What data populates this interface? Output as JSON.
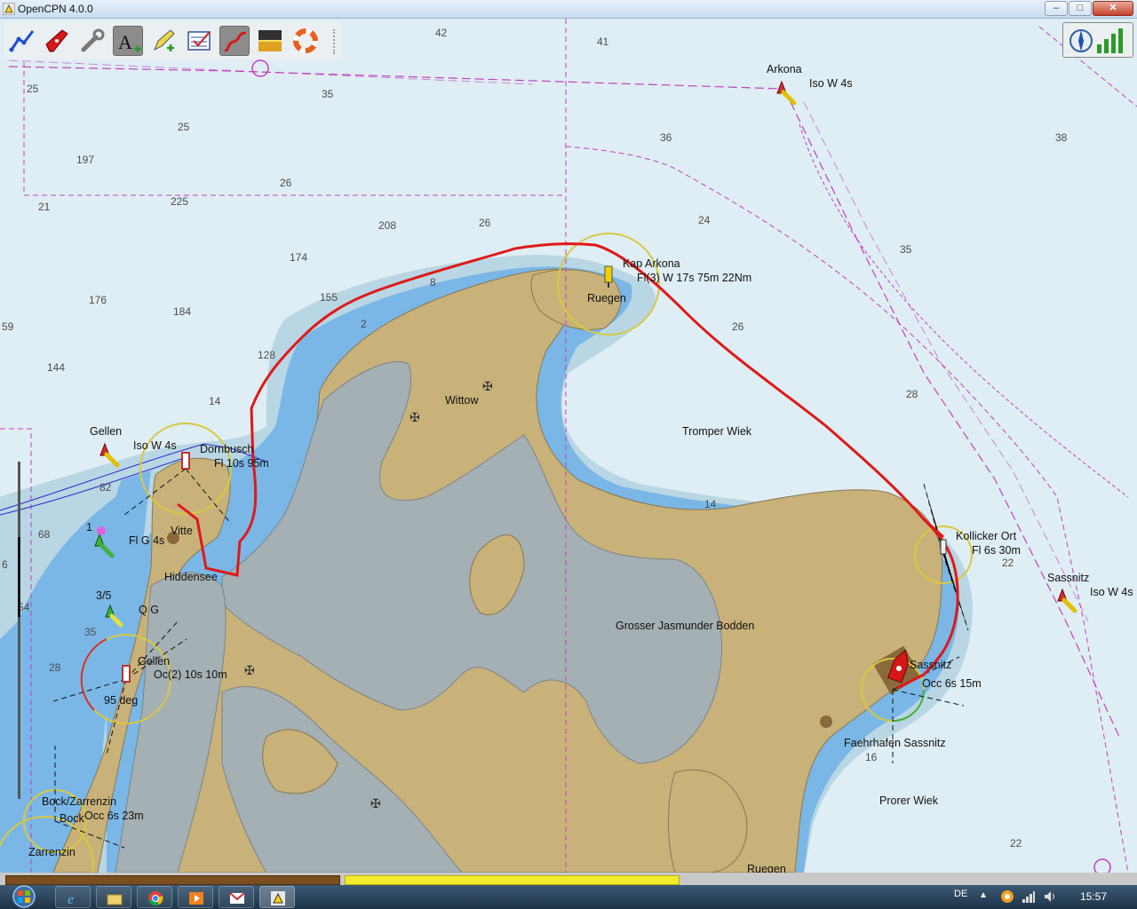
{
  "window": {
    "title": "OpenCPN 4.0.0",
    "minimize_icon": "minimize-icon",
    "maximize_icon": "maximize-icon",
    "close_icon": "close-icon",
    "minimize_glyph": "–",
    "maximize_glyph": "□",
    "close_glyph": "✕"
  },
  "toolbar": {
    "tools": [
      {
        "name": "route-tool",
        "icon": "route-icon"
      },
      {
        "name": "ownship-tool",
        "icon": "ship-icon"
      },
      {
        "name": "settings-tool",
        "icon": "wrench-icon"
      },
      {
        "name": "text-tool",
        "icon": "text-add-icon",
        "active": true
      },
      {
        "name": "mark-tool",
        "icon": "pencil-icon"
      },
      {
        "name": "chart-info-tool",
        "icon": "chart-check-icon"
      },
      {
        "name": "track-tool",
        "icon": "track-icon",
        "active": true
      },
      {
        "name": "color-scheme-tool",
        "icon": "dusk-icon"
      },
      {
        "name": "mob-tool",
        "icon": "lifebuoy-icon"
      }
    ]
  },
  "status_icons": {
    "compass": "compass-icon",
    "gps": "gps-signal-icon"
  },
  "chart": {
    "place_names": {
      "arkona": "Arkona",
      "kap_arkona": "Kap Arkona",
      "ruegen": "Ruegen",
      "wittow": "Wittow",
      "tromper_wiek": "Tromper Wiek",
      "grosser_jasmunder_bodden": "Grosser Jasmunder Bodden",
      "kollicker_ort": "Kollicker Ort",
      "sassnitz_east": "Sassnitz",
      "sassnitz_port": "Sassnitz",
      "faehrhafen": "Faehrhafen Sassnitz",
      "prorer_wiek": "Prorer Wiek",
      "gellen": "Gellen",
      "dornbusch": "Dornbusch",
      "vitte": "Vitte",
      "hiddensee": "Hiddensee",
      "bock_zarrenzin": "Bock/Zarrenzin",
      "bock": "Bock",
      "zarrenzin": "Zarrenzin",
      "gellen_2": "Gellen",
      "ruegen_south": "Ruegen"
    },
    "light_labels": {
      "arkona_iso": "Iso W 4s",
      "kap_arkona_fl": "Fl(3) W 17s 75m 22Nm",
      "kollicker_fl": "Fl 6s 30m",
      "sassnitz_iso": "Iso W 4s",
      "sassnitz_occ": "Occ 6s 15m",
      "gellen_iso": "Iso W 4s",
      "dornbusch_fl": "Fl 10s 95m",
      "fl_g_4s": "Fl G 4s",
      "q_g": "Q G",
      "occ2": "Oc(2) 10s 10m",
      "bock_occ": "Occ 6s 23m",
      "buoy_1": "1",
      "buoy_35": "3/5",
      "leading_95": "95 deg"
    },
    "depths": [
      {
        "id": "d1",
        "value": "42"
      },
      {
        "id": "d2",
        "value": "41"
      },
      {
        "id": "d3",
        "value": "25"
      },
      {
        "id": "d4",
        "value": "35"
      },
      {
        "id": "d5",
        "value": "25"
      },
      {
        "id": "d6",
        "value": "36"
      },
      {
        "id": "d7",
        "value": "38"
      },
      {
        "id": "d8",
        "value": "197"
      },
      {
        "id": "d9",
        "value": "26"
      },
      {
        "id": "d10",
        "value": "21"
      },
      {
        "id": "d11",
        "value": "225"
      },
      {
        "id": "d12",
        "value": "208"
      },
      {
        "id": "d13",
        "value": "26"
      },
      {
        "id": "d14",
        "value": "24"
      },
      {
        "id": "d15",
        "value": "35"
      },
      {
        "id": "d16",
        "value": "174"
      },
      {
        "id": "d17",
        "value": "8"
      },
      {
        "id": "d18",
        "value": "155"
      },
      {
        "id": "d19",
        "value": "176"
      },
      {
        "id": "d20",
        "value": "184"
      },
      {
        "id": "d21",
        "value": "2"
      },
      {
        "id": "d22",
        "value": "26"
      },
      {
        "id": "d23",
        "value": "128"
      },
      {
        "id": "d24",
        "value": "144"
      },
      {
        "id": "d25",
        "value": "14"
      },
      {
        "id": "d26",
        "value": "28"
      },
      {
        "id": "d27",
        "value": "14"
      },
      {
        "id": "d28",
        "value": "82"
      },
      {
        "id": "d29",
        "value": "68"
      },
      {
        "id": "d30",
        "value": "22"
      },
      {
        "id": "d31",
        "value": "35"
      },
      {
        "id": "d32",
        "value": "28"
      },
      {
        "id": "d33",
        "value": "16"
      },
      {
        "id": "d34",
        "value": "22"
      },
      {
        "id": "d35",
        "value": "59"
      },
      {
        "id": "d36",
        "value": "6"
      },
      {
        "id": "d37",
        "value": "54"
      }
    ]
  },
  "taskbar": {
    "apps": [
      {
        "name": "ie",
        "icon": "internet-explorer-icon"
      },
      {
        "name": "explorer",
        "icon": "folder-icon"
      },
      {
        "name": "chrome",
        "icon": "chrome-icon"
      },
      {
        "name": "media",
        "icon": "media-player-icon"
      },
      {
        "name": "gmail",
        "icon": "mail-icon"
      },
      {
        "name": "opencpn",
        "icon": "opencpn-icon"
      }
    ],
    "language": "DE",
    "time": "15:57",
    "show_hidden_glyph": "▲"
  }
}
